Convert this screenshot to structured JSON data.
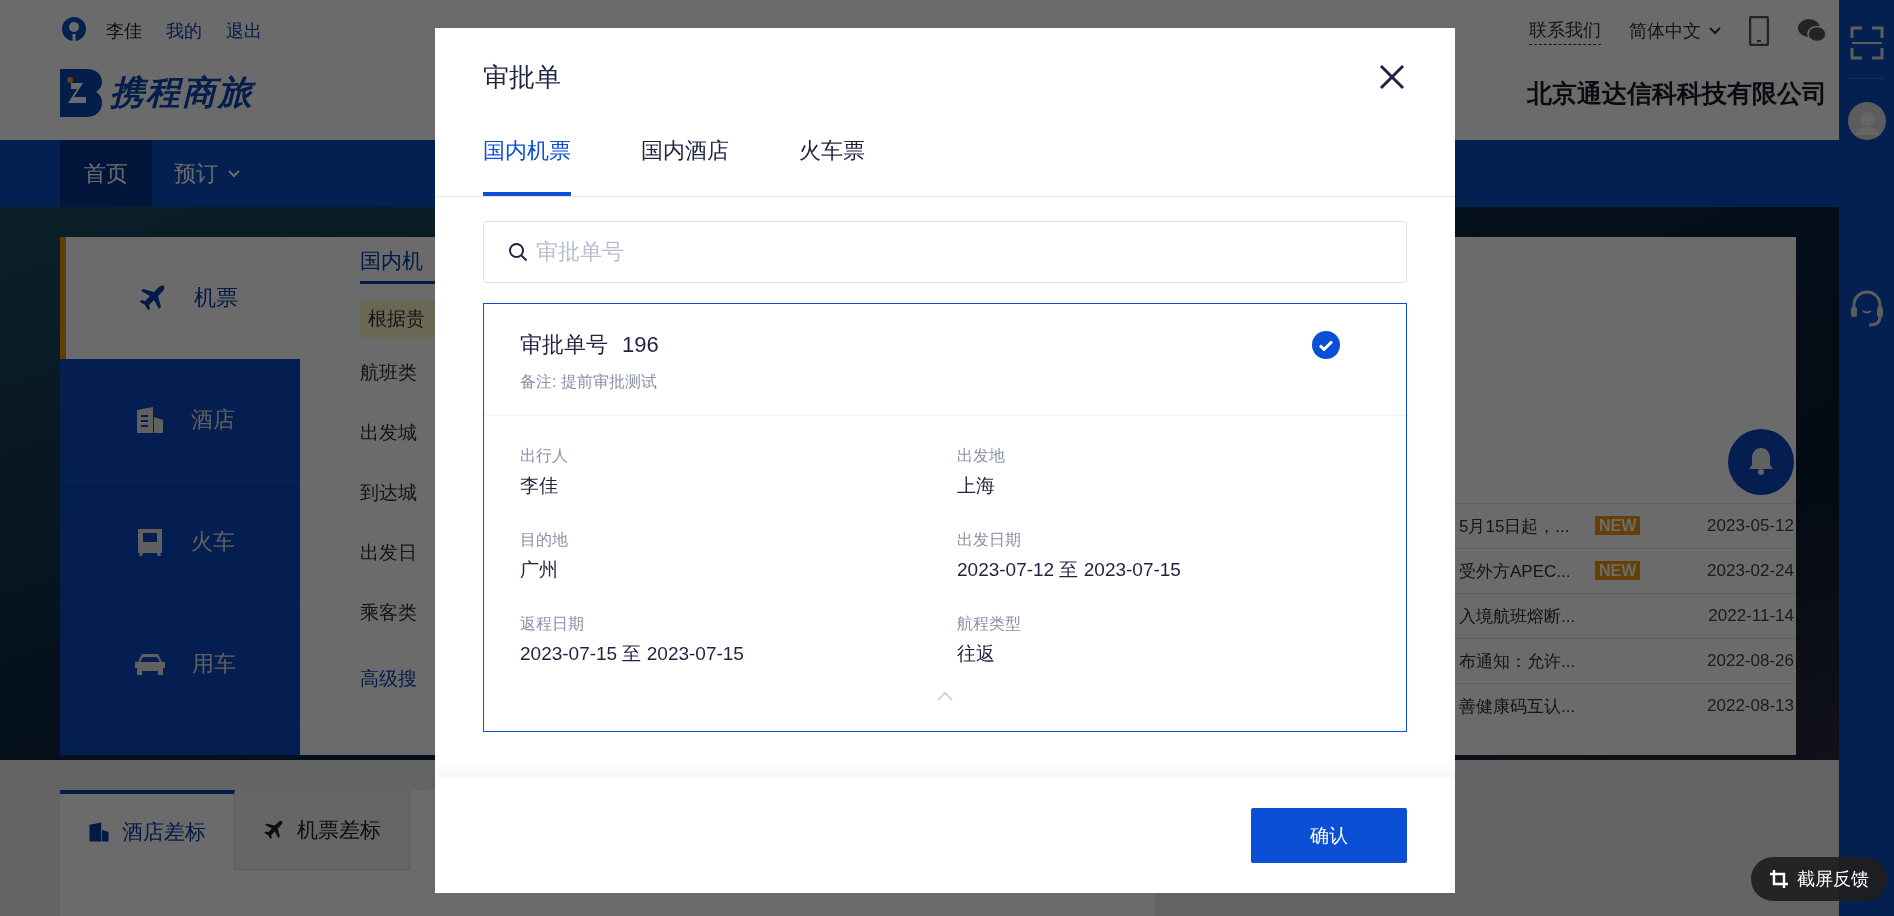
{
  "header": {
    "user_name": "李佳",
    "links": [
      {
        "label": "我的"
      },
      {
        "label": "退出"
      }
    ],
    "contact": "联系我们",
    "language": "简体中文",
    "logo": "携程商旅",
    "company": "北京通达信科科技有限公司"
  },
  "nav": [
    {
      "label": "首页",
      "selected": true,
      "has_menu": false
    },
    {
      "label": "预订",
      "selected": false,
      "has_menu": true
    }
  ],
  "booking": {
    "categories": [
      {
        "label": "机票",
        "kind": "plane",
        "selected": true
      },
      {
        "label": "酒店",
        "kind": "hotel",
        "selected": false
      },
      {
        "label": "火车",
        "kind": "train",
        "selected": false
      },
      {
        "label": "用车",
        "kind": "car",
        "selected": false
      }
    ],
    "form": {
      "tab": "国内机",
      "notice": "根据贵",
      "fields": [
        "航班类",
        "出发城",
        "到达城",
        "出发日",
        "乘客类"
      ],
      "advanced_link": "高级搜"
    }
  },
  "news": [
    {
      "title": "5月15日起，...",
      "badge": "NEW",
      "date": "2023-05-12"
    },
    {
      "title": "受外方APEC...",
      "badge": "NEW",
      "date": "2023-02-24"
    },
    {
      "title": "入境航班熔断...",
      "date": "2022-11-14"
    },
    {
      "title": "布通知：允许...",
      "date": "2022-08-26"
    },
    {
      "title": "善健康码互认...",
      "date": "2022-08-13"
    }
  ],
  "bottom_tabs": [
    {
      "label": "酒店差标",
      "kind": "hotel",
      "selected": true
    },
    {
      "label": "机票差标",
      "kind": "plane",
      "selected": false
    }
  ],
  "feedback_button": "截屏反馈",
  "dialog": {
    "title": "审批单",
    "tabs": [
      {
        "label": "国内机票",
        "selected": true
      },
      {
        "label": "国内酒店",
        "selected": false
      },
      {
        "label": "火车票",
        "selected": false
      }
    ],
    "search": {
      "placeholder": "审批单号"
    },
    "approvals": [
      {
        "number_label": "审批单号",
        "number": "196",
        "selected": true,
        "remark": "备注: 提前审批测试",
        "expanded": true,
        "fields": [
          {
            "label": "出行人",
            "value": "李佳"
          },
          {
            "label": "出发地",
            "value": "上海"
          },
          {
            "label": "目的地",
            "value": "广州"
          },
          {
            "label": "出发日期",
            "value": "2023-07-12 至 2023-07-15"
          },
          {
            "label": "返程日期",
            "value": "2023-07-15 至 2023-07-15"
          },
          {
            "label": "航程类型",
            "value": "往返"
          }
        ]
      }
    ],
    "confirm_button": "确认"
  }
}
